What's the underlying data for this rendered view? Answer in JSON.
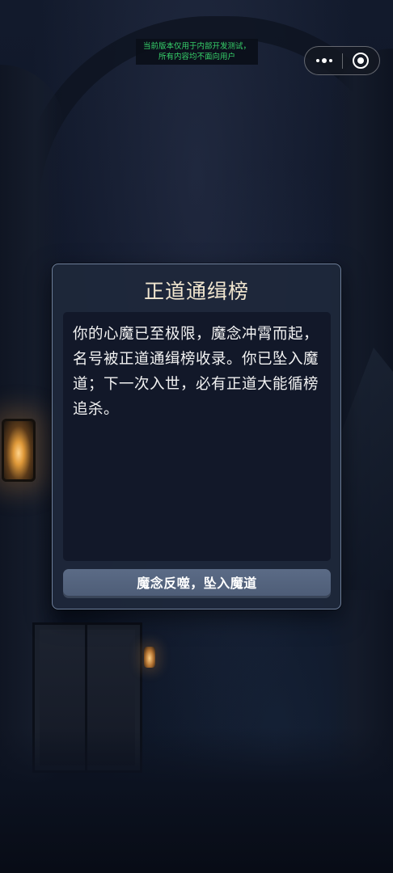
{
  "notice": {
    "line1": "当前版本仅用于内部开发测试，",
    "line2": "所有内容均不面向用户"
  },
  "capsule": {
    "more_icon": "more-dots-icon",
    "close_icon": "target-close-icon"
  },
  "dialog": {
    "title": "正道通缉榜",
    "body": "你的心魔已至极限，魔念冲霄而起，名号被正道通缉榜收录。你已坠入魔道；下一次入世，必有正道大能循榜追杀。",
    "button_label": "魔念反噬，坠入魔道"
  },
  "colors": {
    "title": "#f1e6cf",
    "notice_text": "#37d36b",
    "button_bg": "#56657f",
    "dialog_border": "#6f809c"
  }
}
